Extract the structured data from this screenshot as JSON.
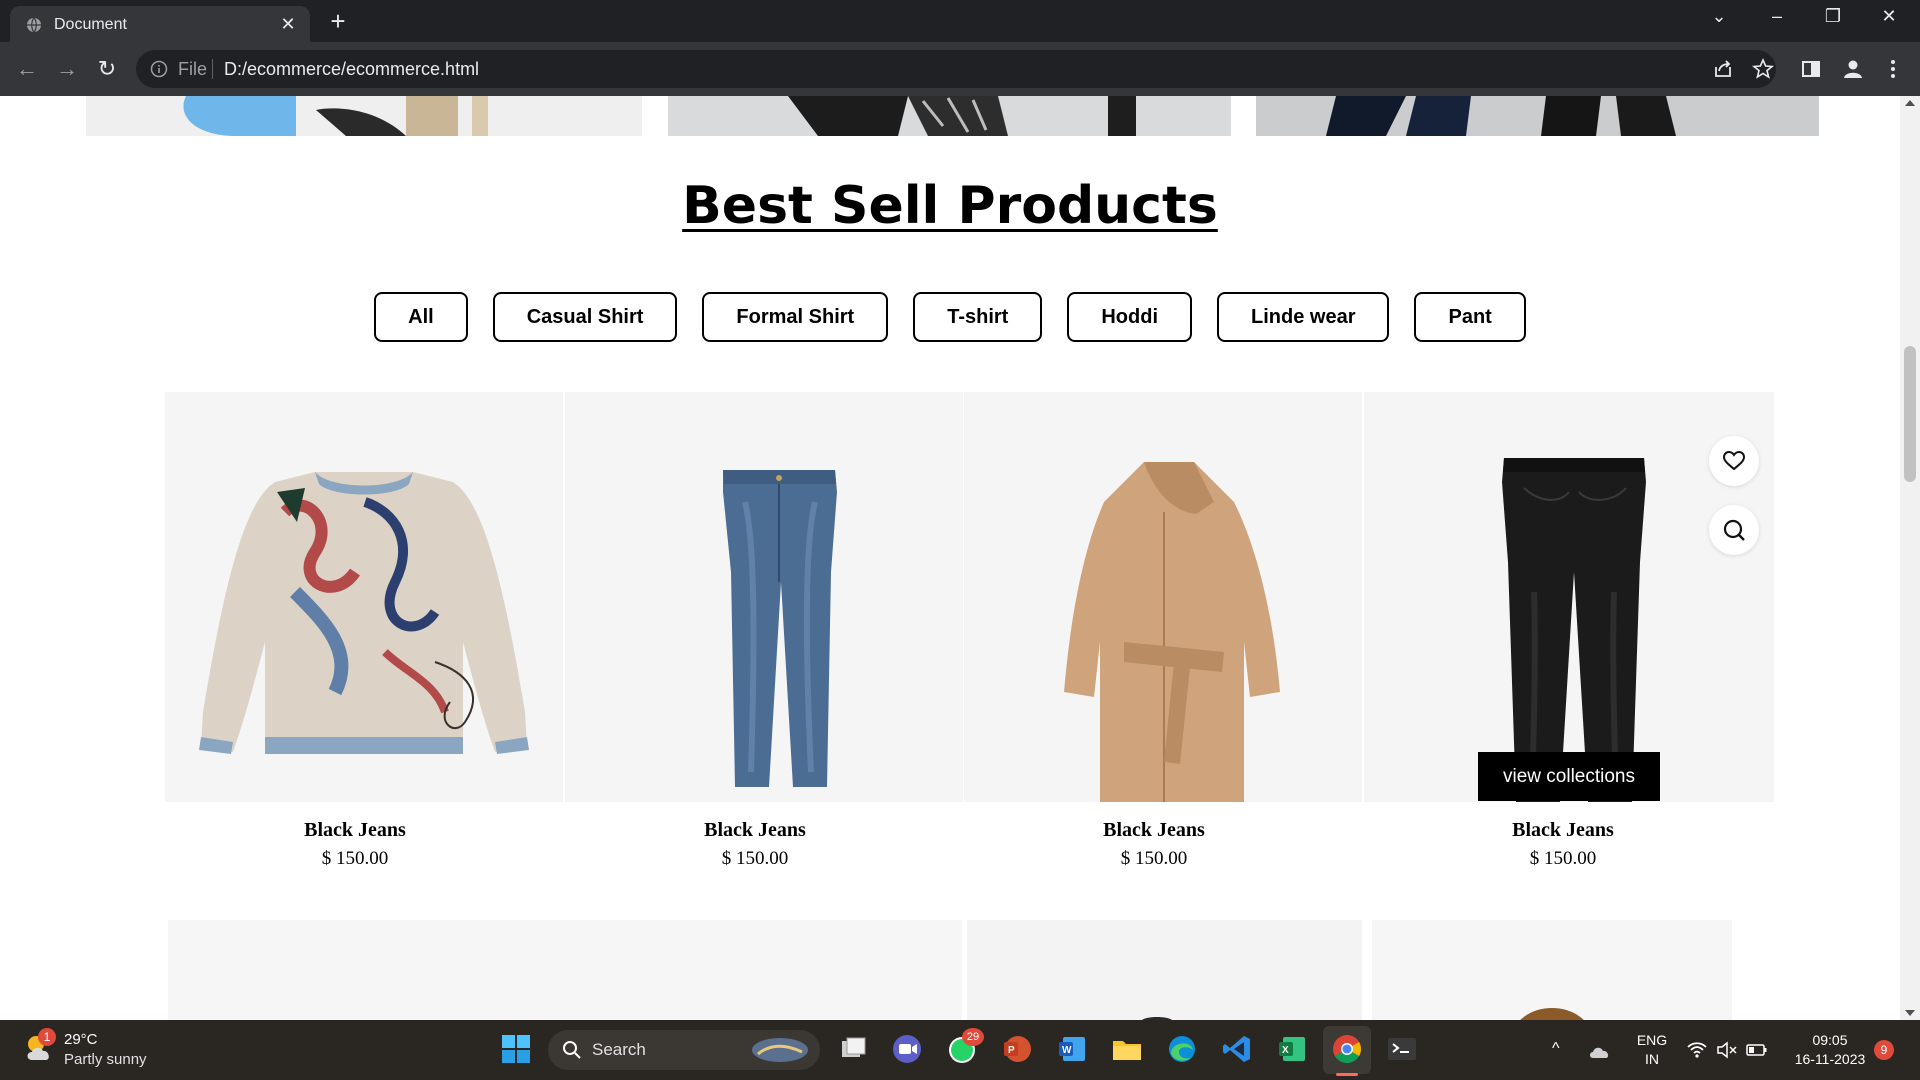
{
  "browser": {
    "tab_title": "Document",
    "omnibox_scheme": "File",
    "url": "D:/ecommerce/ecommerce.html"
  },
  "page": {
    "section_title": "Best Sell Products",
    "filters": [
      "All",
      "Casual Shirt",
      "Formal Shirt",
      "T-shirt",
      "Hoddi",
      "Linde wear",
      "Pant"
    ],
    "products": [
      {
        "name": "Black Jeans",
        "price": "$ 150.00",
        "image": "sweater"
      },
      {
        "name": "Black Jeans",
        "price": "$ 150.00",
        "image": "blue-jeans"
      },
      {
        "name": "Black Jeans",
        "price": "$ 150.00",
        "image": "camel-coat"
      },
      {
        "name": "Black Jeans",
        "price": "$ 150.00",
        "image": "black-jeans"
      }
    ],
    "view_collections_label": "view collections",
    "hover_actions": [
      "heart-icon",
      "search-icon"
    ]
  },
  "taskbar": {
    "weather_temp": "29°C",
    "weather_desc": "Partly sunny",
    "weather_badge": "1",
    "search_label": "Search",
    "whatsapp_badge": "29",
    "language_line1": "ENG",
    "language_line2": "IN",
    "time": "09:05",
    "date": "16-11-2023",
    "notification_count": "9"
  },
  "colors": {
    "chrome_dark": "#202124",
    "chrome_toolbar": "#35363a",
    "product_bg": "#f5f5f5",
    "taskbar_bg": "#2a2622",
    "accent_button": "#000000"
  }
}
